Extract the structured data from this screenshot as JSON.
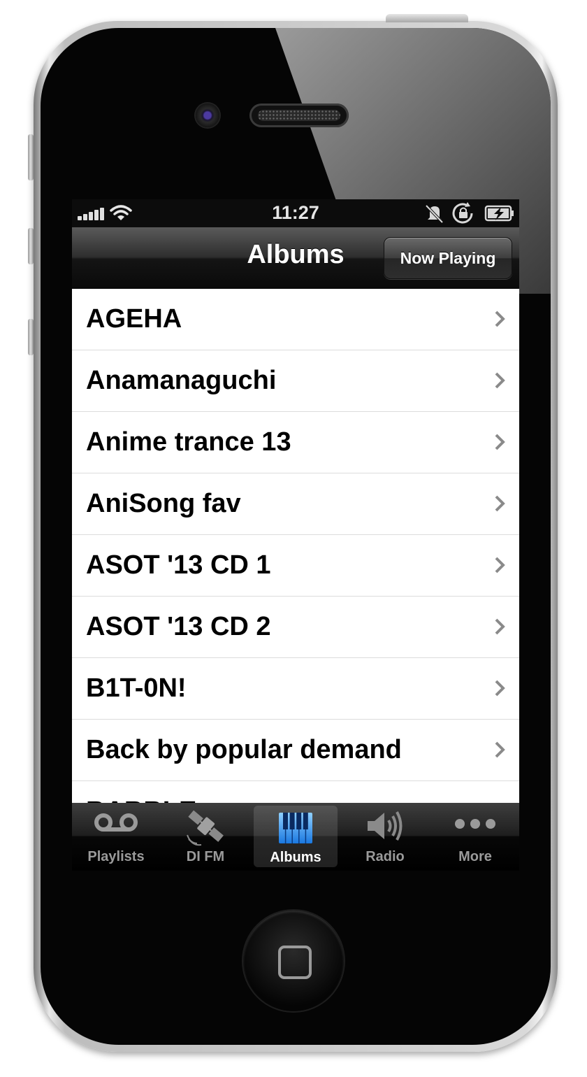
{
  "status_bar": {
    "time": "11:27",
    "icons": [
      "signal-icon",
      "wifi-icon",
      "mute-icon",
      "rotation-lock-icon",
      "battery-charging-icon"
    ]
  },
  "nav_bar": {
    "title": "Albums",
    "now_playing_label": "Now Playing"
  },
  "albums": [
    "AGEHA",
    "Anamanaguchi",
    "Anime trance 13",
    "AniSong fav",
    "ASOT '13 CD 1",
    "ASOT '13 CD 2",
    "B1T-0N!",
    "Back by popular demand",
    "BABBLE..."
  ],
  "tab_bar": {
    "tabs": [
      {
        "label": "Playlists",
        "icon": "voicemail-icon"
      },
      {
        "label": "DI FM",
        "icon": "satellite-icon"
      },
      {
        "label": "Albums",
        "icon": "piano-keys-icon",
        "selected": true
      },
      {
        "label": "Radio",
        "icon": "speaker-icon"
      },
      {
        "label": "More",
        "icon": "more-dots-icon"
      }
    ]
  },
  "colors": {
    "selected_tab_icon": "#3a9bf0",
    "list_background": "#ffffff",
    "bar_background": "#0a0a0a"
  }
}
